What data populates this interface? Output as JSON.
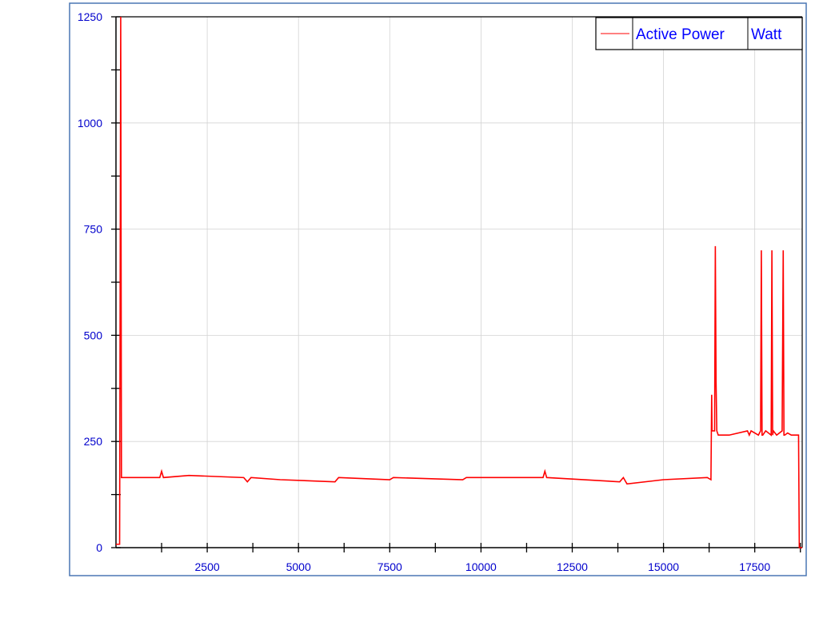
{
  "chart_data": {
    "type": "line",
    "title": "",
    "xlabel": "",
    "ylabel": "",
    "xlim": [
      0,
      18800
    ],
    "ylim": [
      0,
      1250
    ],
    "grid": true,
    "legend_placement": "top-right",
    "x_ticks": [
      "2500",
      "5000",
      "7500",
      "10000",
      "12500",
      "15000",
      "17500"
    ],
    "y_ticks": [
      "0",
      "250",
      "500",
      "750",
      "1000",
      "1250"
    ],
    "x_tick_values": [
      2500,
      5000,
      7500,
      10000,
      12500,
      15000,
      17500
    ],
    "y_tick_values": [
      0,
      250,
      500,
      750,
      1000,
      1250
    ],
    "series": [
      {
        "name": "Active Power",
        "unit": "Watt",
        "color": "#ff0000",
        "x": [
          0,
          100,
          130,
          150,
          170,
          200,
          300,
          1200,
          1250,
          1300,
          2000,
          3500,
          3600,
          3700,
          4500,
          6000,
          6100,
          7500,
          7600,
          9500,
          9600,
          11700,
          11750,
          11800,
          13800,
          13900,
          14000,
          15000,
          16200,
          16300,
          16320,
          16330,
          16400,
          16420,
          16440,
          16460,
          16500,
          16600,
          16800,
          17300,
          17350,
          17400,
          17600,
          17660,
          17680,
          17700,
          17720,
          17800,
          17950,
          17970,
          17990,
          18010,
          18100,
          18250,
          18280,
          18300,
          18320,
          18400,
          18500,
          18680,
          18700,
          18720,
          18800
        ],
        "y": [
          8,
          8,
          1250,
          165,
          165,
          165,
          165,
          165,
          180,
          165,
          170,
          165,
          155,
          165,
          160,
          155,
          165,
          160,
          165,
          160,
          165,
          165,
          180,
          165,
          155,
          165,
          150,
          160,
          165,
          160,
          360,
          275,
          275,
          710,
          390,
          275,
          265,
          265,
          265,
          275,
          265,
          275,
          265,
          275,
          700,
          265,
          265,
          275,
          265,
          700,
          265,
          275,
          265,
          275,
          700,
          265,
          265,
          270,
          265,
          265,
          265,
          0,
          0
        ]
      }
    ],
    "legend": [
      {
        "label": "Active Power",
        "unit": "Watt",
        "color": "#ff0000"
      }
    ]
  },
  "colors": {
    "frame_border": "#4a77b4",
    "axis": "#000000",
    "tick_label": "#0000cc",
    "grid": "#d3d3d3",
    "legend_text": "#0000ff"
  }
}
